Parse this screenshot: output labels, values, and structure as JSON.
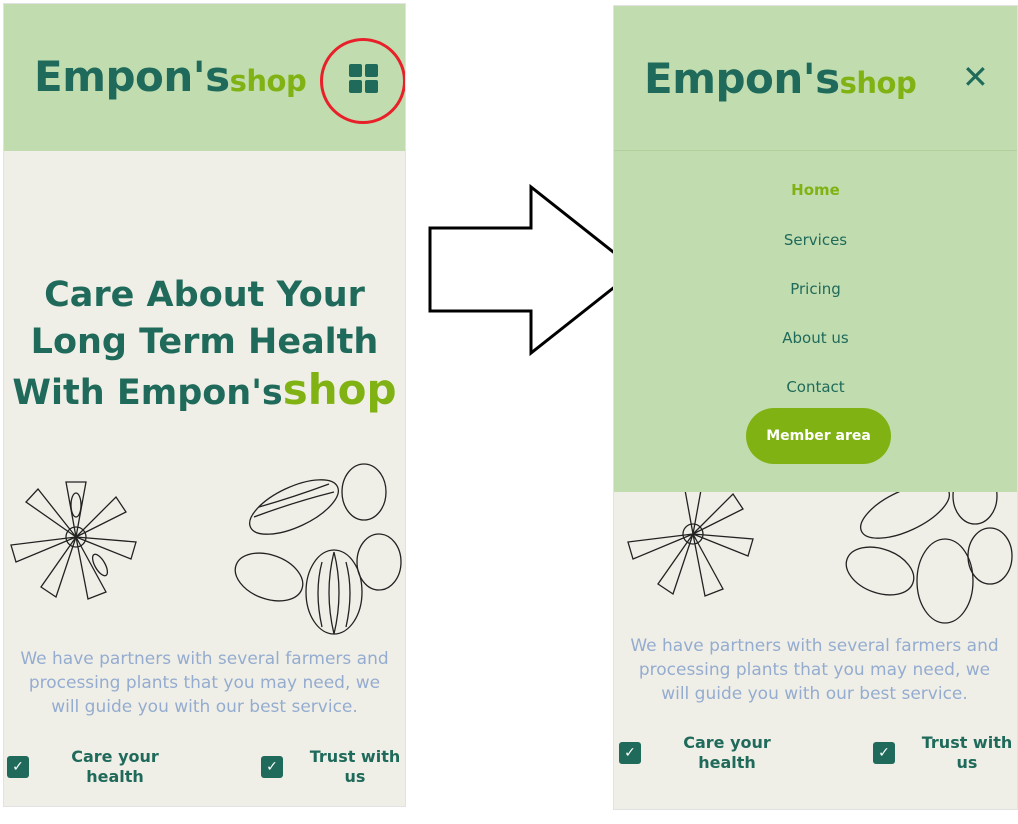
{
  "brand": {
    "name": "Empon's",
    "suffix": "shop"
  },
  "hero": {
    "line1": "Care About Your",
    "line2": "Long Term Health",
    "line3": "With Empon's",
    "line3_suffix": "shop"
  },
  "description": "We have partners with several farmers and processing plants that you may need, we will guide you with our best service.",
  "features": [
    {
      "label": "Care your health"
    },
    {
      "label": "Trust with us"
    }
  ],
  "menu": {
    "items": [
      {
        "label": "Home",
        "active": true
      },
      {
        "label": "Services"
      },
      {
        "label": "Pricing"
      },
      {
        "label": "About us"
      },
      {
        "label": "Contact"
      }
    ],
    "member_button": "Member area"
  },
  "icons": {
    "menu": "grid-menu-icon",
    "close": "close-icon",
    "check": "checkbox-checked-icon"
  },
  "colors": {
    "header": "#c1ddb0",
    "primary": "#1f6a5a",
    "accent": "#80b213",
    "highlight": "#e8202a"
  }
}
